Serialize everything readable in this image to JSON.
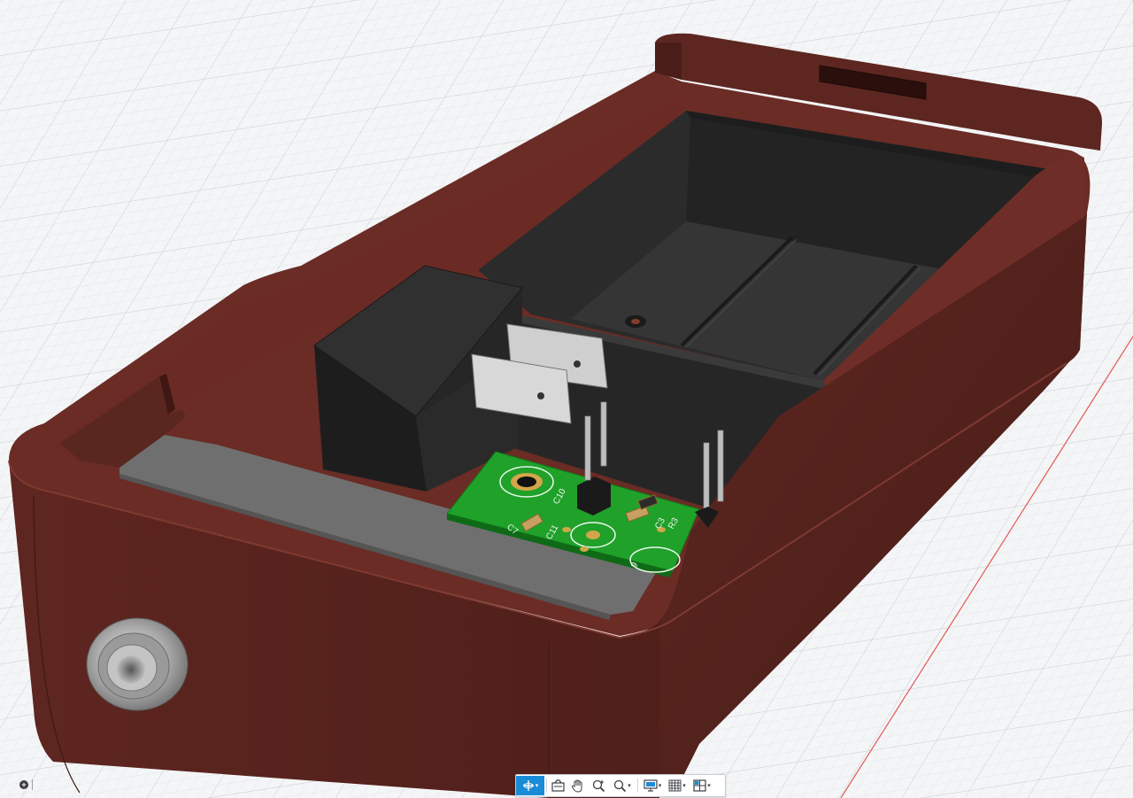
{
  "window": {
    "title": ""
  },
  "viewport": {
    "background": "#f4f5f7",
    "grid_color": "#d7dbe0",
    "axis_color": "#e05a55",
    "enclosure_color": "#5b2620",
    "insert_color": "#2f2f2f",
    "pcb_color": "#1fa12a",
    "silkscreen": {
      "c7": "C7",
      "c11": "C11",
      "c10": "C10",
      "c3": "C3",
      "r3": "R3",
      "nine": "9"
    }
  },
  "left_widget": {
    "icon": "plus-circle-icon"
  },
  "toolbar": {
    "accent": "#1a8bd6",
    "buttons": [
      {
        "name": "orbit-button",
        "icon": "orbit-icon",
        "has_menu": true,
        "active": true
      },
      {
        "name": "look-at-button",
        "icon": "look-at-icon",
        "has_menu": false,
        "active": false
      },
      {
        "name": "pan-button",
        "icon": "hand-icon",
        "has_menu": false,
        "active": false
      },
      {
        "name": "zoom-button",
        "icon": "zoom-icon",
        "has_menu": false,
        "active": false
      },
      {
        "name": "fit-button",
        "icon": "zoom-fit-icon",
        "has_menu": true,
        "active": false
      },
      {
        "name": "display-settings-button",
        "icon": "monitor-icon",
        "has_menu": true,
        "active": false
      },
      {
        "name": "grid-snaps-button",
        "icon": "grid-icon",
        "has_menu": true,
        "active": false
      },
      {
        "name": "viewports-button",
        "icon": "viewports-icon",
        "has_menu": true,
        "active": false
      }
    ],
    "caret": "▾"
  }
}
